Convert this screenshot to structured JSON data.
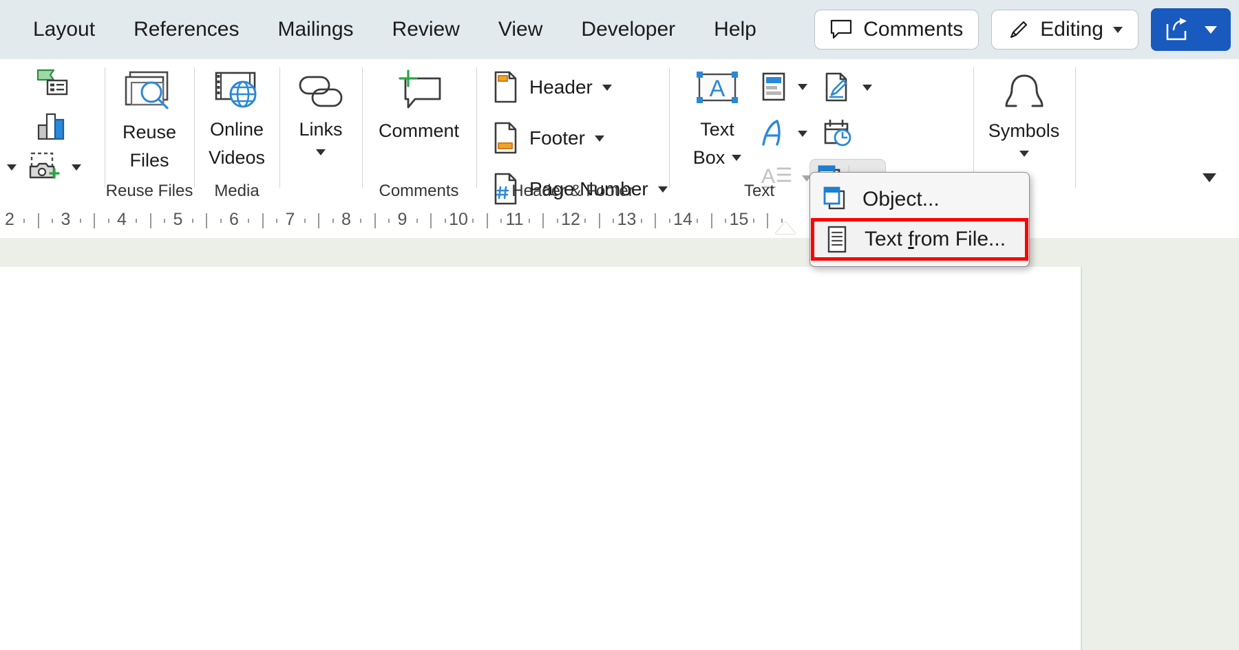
{
  "colors": {
    "tabbar_bg": "#e3eaee",
    "accent_blue": "#185abd",
    "icon_blue": "#1f7fd0",
    "icon_green": "#4caf50",
    "icon_orange": "#e8820c",
    "highlight_red": "#ff0000",
    "doc_gray": "#eceee8"
  },
  "tabbar": {
    "tabs": [
      {
        "label": "Layout"
      },
      {
        "label": "References"
      },
      {
        "label": "Mailings"
      },
      {
        "label": "Review"
      },
      {
        "label": "View"
      },
      {
        "label": "Developer"
      },
      {
        "label": "Help"
      }
    ],
    "comments_label": "Comments",
    "comments_icon": "comment-bubble-icon",
    "editing_label": "Editing",
    "editing_icon": "pencil-icon",
    "share_icon": "share-arrow-icon"
  },
  "ribbon": {
    "groups": [
      {
        "name": "illustrations-overflow",
        "label": "",
        "small_buttons": [
          {
            "icon": "smartart-icon",
            "label": ""
          },
          {
            "icon": "chart-icon",
            "label": ""
          },
          {
            "icon": "screenshot-icon",
            "label": ""
          }
        ]
      },
      {
        "name": "reuse-files",
        "label": "Reuse Files",
        "big_button": {
          "icon": "reuse-files-icon",
          "line1": "Reuse",
          "line2": "Files"
        }
      },
      {
        "name": "media",
        "label": "Media",
        "big_button": {
          "icon": "online-videos-icon",
          "line1": "Online",
          "line2": "Videos"
        }
      },
      {
        "name": "links",
        "label": "",
        "big_button": {
          "icon": "links-chain-icon",
          "line1": "Links",
          "line2": ""
        }
      },
      {
        "name": "comments",
        "label": "Comments",
        "big_button": {
          "icon": "new-comment-icon",
          "line1": "Comment",
          "line2": ""
        }
      },
      {
        "name": "header-footer",
        "label": "Header & Footer",
        "small_buttons": [
          {
            "icon": "header-page-icon",
            "label": "Header"
          },
          {
            "icon": "footer-page-icon",
            "label": "Footer"
          },
          {
            "icon": "page-number-icon",
            "label": "Page Number"
          }
        ]
      },
      {
        "name": "text",
        "label": "Text",
        "big_button": {
          "icon": "text-box-icon",
          "line1": "Text",
          "line2": "Box"
        },
        "small_buttons": [
          {
            "icon": "quick-parts-icon",
            "label": ""
          },
          {
            "icon": "wordart-icon",
            "label": ""
          },
          {
            "icon": "drop-cap-icon",
            "label": "",
            "disabled": true
          },
          {
            "icon": "signature-line-icon",
            "label": ""
          },
          {
            "icon": "date-time-icon",
            "label": ""
          },
          {
            "icon": "object-icon",
            "label": "",
            "active": true
          }
        ]
      },
      {
        "name": "symbols",
        "label": "",
        "big_button": {
          "icon": "omega-symbol-icon",
          "line1": "Symbols",
          "line2": ""
        }
      }
    ],
    "expand_icon": "chevron-down-icon"
  },
  "ruler": {
    "ticks": [
      "2",
      "3",
      "4",
      "5",
      "6",
      "7",
      "8",
      "9",
      "10",
      "11",
      "12",
      "13",
      "14",
      "15"
    ],
    "unit": "in"
  },
  "menu": {
    "items": [
      {
        "id": "object",
        "label": "Object...",
        "icon": "object-icon",
        "accelerator": "",
        "highlighted": false
      },
      {
        "id": "text-from-file",
        "label_before": "Text ",
        "accelerator": "f",
        "label_after": "rom File...",
        "label": "Text from File...",
        "icon": "text-from-file-icon",
        "highlighted": true
      }
    ]
  }
}
